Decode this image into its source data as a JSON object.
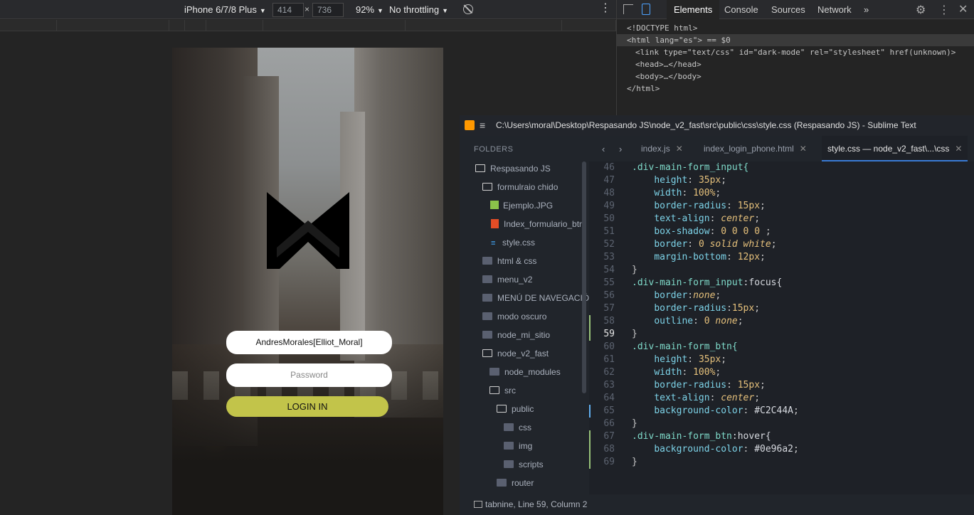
{
  "device_toolbar": {
    "device": "iPhone 6/7/8 Plus",
    "width": "414",
    "height": "736",
    "zoom": "92%",
    "throttle": "No throttling"
  },
  "phone": {
    "username_value": "AndresMorales[Elliot_Moral]",
    "password_placeholder": "Password",
    "login_label": "LOGIN IN",
    "button_color": "#C2C44A"
  },
  "devtools": {
    "tabs": [
      "Elements",
      "Console",
      "Sources",
      "Network"
    ],
    "more": "»",
    "lines": [
      "<!DOCTYPE html>",
      "<html lang=\"es\"> == $0",
      "<link type=\"text/css\" id=\"dark-mode\" rel=\"stylesheet\" href(unknown)>",
      "<head>…</head>",
      "<body>…</body>",
      "</html>"
    ]
  },
  "sublime": {
    "title": "C:\\Users\\moral\\Desktop\\Respasando JS\\node_v2_fast\\src\\public\\css\\style.css (Respasando JS) - Sublime Text (UNREGISTERED)",
    "folders_header": "FOLDERS",
    "tree": [
      "Respasando JS",
      "formulraio chido",
      "Ejemplo.JPG",
      "Index_formulario_btn",
      "style.css",
      "html & css",
      "menu_v2",
      "MENÚ DE NAVEGACIÓN",
      "modo oscuro",
      "node_mi_sitio",
      "node_v2_fast",
      "node_modules",
      "src",
      "public",
      "css",
      "img",
      "scripts",
      "router"
    ],
    "tabs": [
      "index.js",
      "index_login_phone.html",
      "style.css — node_v2_fast\\...\\css"
    ],
    "status": "tabnine, Line 59, Column 2"
  },
  "code": {
    "l46": ".div-main-form_input{",
    "l47a": "height",
    "l47b": "35px",
    "l48a": "width",
    "l48b": "100%",
    "l49a": "border-radius",
    "l49b": "15px",
    "l50a": "text-align",
    "l50b": "center",
    "l51a": "box-shadow",
    "l51b": "0 0 0 0",
    "l52a": "border",
    "l52b": "0",
    "l52c": "solid white",
    "l53a": "margin-bottom",
    "l53b": "12px",
    "l55a": ".div-main-form_input",
    "l55b": ":focus{",
    "l56a": "border",
    "l56b": "none",
    "l57a": "border-radius",
    "l57b": "15px",
    "l58a": "outline",
    "l58b": "0",
    "l58c": "none",
    "l60": ".div-main-form_btn{",
    "l61a": "height",
    "l61b": "35px",
    "l62a": "width",
    "l62b": "100%",
    "l63a": "border-radius",
    "l63b": "15px",
    "l64a": "text-align",
    "l64b": "center",
    "l65a": "background-color",
    "l65b": "#C2C44A",
    "l67a": ".div-main-form_btn",
    "l67b": ":hover{",
    "l68a": "background-color",
    "l68b": "#0e96a2"
  }
}
